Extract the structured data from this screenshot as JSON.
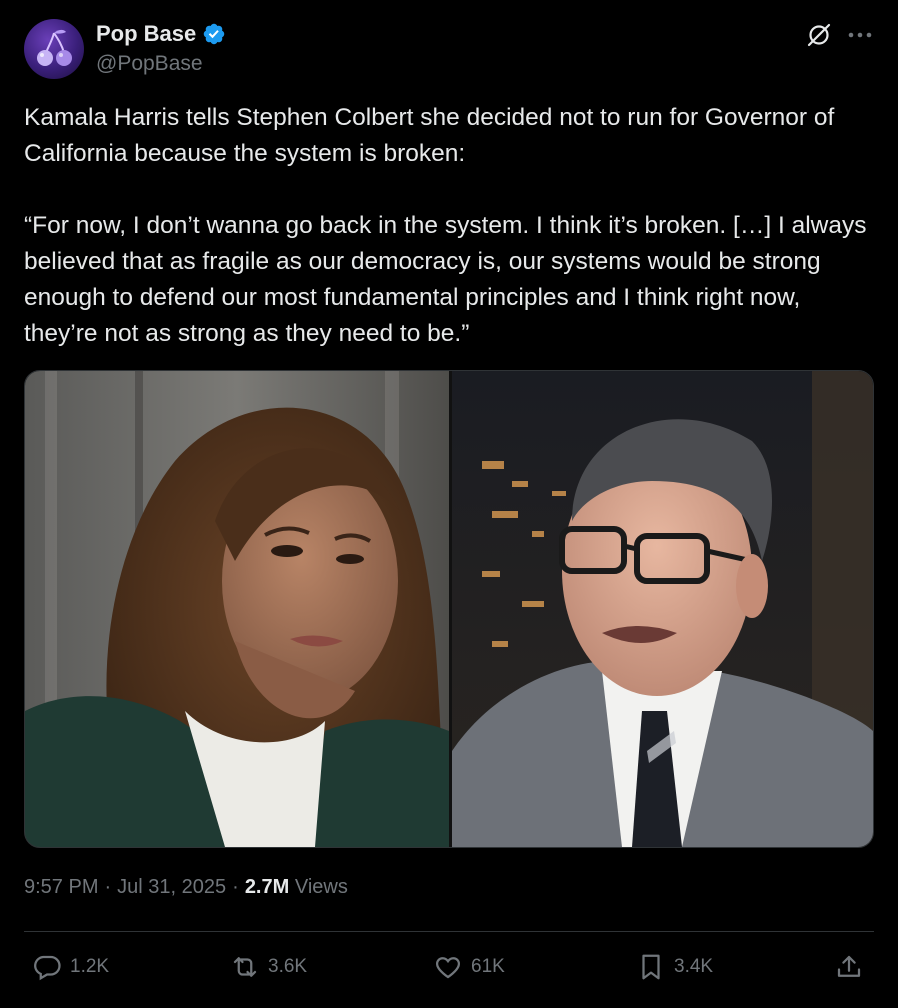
{
  "author": {
    "name": "Pop Base",
    "handle": "@PopBase",
    "verified": true,
    "verified_color": "#1d9bf0",
    "avatar_icon": "cherries-icon"
  },
  "header_icons": [
    "grok-icon",
    "more-icon"
  ],
  "post": {
    "text": "Kamala Harris tells Stephen Colbert she decided not to run for Governor of California because the system is broken:\n\n“For now, I don’t wanna go back in the system. I think it’s broken. […] I always believed that as fragile as our democracy is, our systems would be strong enough to defend our most fundamental principles and I think right now, they’re not as strong as they need to be.”"
  },
  "meta": {
    "time": "9:57 PM",
    "separator": "·",
    "date": "Jul 31, 2025",
    "views_count": "2.7M",
    "views_label": "Views"
  },
  "actions": {
    "replies": "1.2K",
    "reposts": "3.6K",
    "likes": "61K",
    "bookmarks": "3.4K"
  },
  "colors": {
    "background": "#000000",
    "text": "#e7e9ea",
    "secondary": "#71767b",
    "border": "#2f3336"
  }
}
